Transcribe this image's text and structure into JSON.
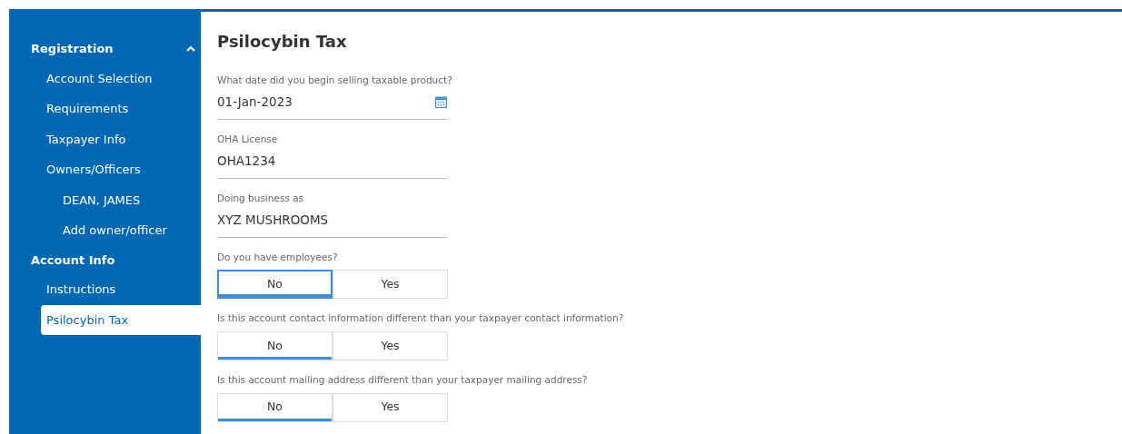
{
  "sidebar": {
    "sections": [
      {
        "label": "Registration",
        "expanded": true,
        "children": [
          {
            "label": "Account Selection",
            "selected": false
          },
          {
            "label": "Requirements",
            "selected": false
          },
          {
            "label": "Taxpayer Info",
            "selected": false
          },
          {
            "label": "Owners/Officers",
            "selected": false,
            "children": [
              {
                "label": "DEAN, JAMES",
                "selected": false
              },
              {
                "label": "Add owner/officer",
                "selected": false
              }
            ]
          }
        ]
      },
      {
        "label": "Account Info",
        "children": [
          {
            "label": "Instructions",
            "selected": false
          },
          {
            "label": "Psilocybin Tax",
            "selected": true
          }
        ]
      }
    ]
  },
  "page": {
    "title": "Psilocybin Tax",
    "fields": [
      {
        "kind": "date",
        "label": "What date did you begin selling taxable product?",
        "value": "01-Jan-2023"
      },
      {
        "kind": "text",
        "label": "OHA License",
        "value": "OHA1234"
      },
      {
        "kind": "text",
        "label": "Doing business as",
        "value": "XYZ MUSHROOMS"
      }
    ],
    "questions": [
      {
        "label": "Do you have employees?",
        "options": [
          {
            "label": "No",
            "selected": true,
            "focused": true
          },
          {
            "label": "Yes",
            "selected": false,
            "focused": false
          }
        ]
      },
      {
        "label": "Is this account contact information different than your taxpayer contact information?",
        "options": [
          {
            "label": "No",
            "selected": true,
            "focused": false
          },
          {
            "label": "Yes",
            "selected": false,
            "focused": false
          }
        ]
      },
      {
        "label": "Is this account mailing address different than your taxpayer mailing address?",
        "options": [
          {
            "label": "No",
            "selected": true,
            "focused": false
          },
          {
            "label": "Yes",
            "selected": false,
            "focused": false
          }
        ]
      }
    ]
  }
}
